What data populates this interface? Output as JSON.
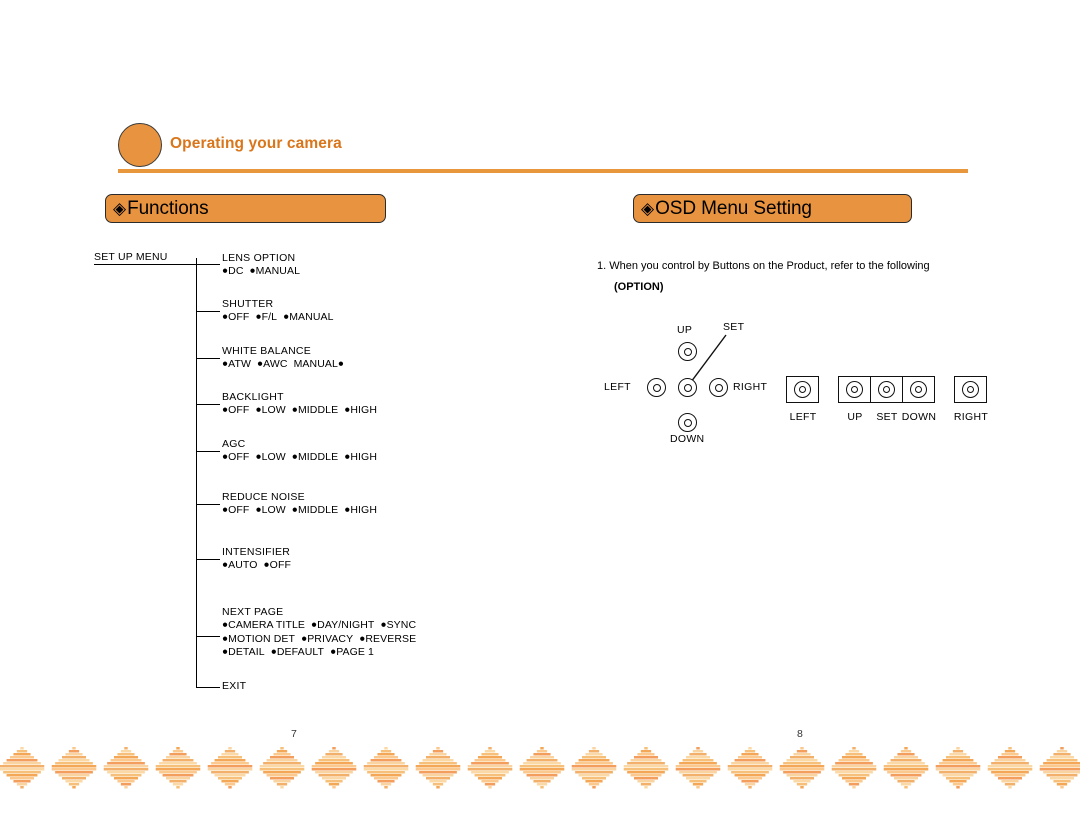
{
  "header": {
    "title": "Operating your camera",
    "circle_color": "#E8933F",
    "title_color": "#D9751A",
    "rule_color": "#E8973C"
  },
  "sections": {
    "functions": {
      "diamond": "◈",
      "label": "Functions"
    },
    "osd": {
      "diamond": "◈",
      "label": "OSD Menu Setting"
    }
  },
  "menu_tree": {
    "root_label": "SET UP MENU",
    "bullet": "●",
    "nodes": [
      {
        "title": "LENS OPTION",
        "options": [
          {
            "text": "DC",
            "bullet_before": true
          },
          {
            "text": "MANUAL",
            "bullet_before": true
          }
        ]
      },
      {
        "title": "SHUTTER",
        "options": [
          {
            "text": "OFF",
            "bullet_before": true
          },
          {
            "text": "F/L",
            "bullet_before": true
          },
          {
            "text": "MANUAL",
            "bullet_before": true
          }
        ]
      },
      {
        "title": "WHITE BALANCE",
        "options": [
          {
            "text": "ATW",
            "bullet_before": true
          },
          {
            "text": "AWC",
            "bullet_before": true
          },
          {
            "text": "MANUAL",
            "bullet_before": false
          }
        ]
      },
      {
        "title": "BACKLIGHT",
        "options": [
          {
            "text": "OFF",
            "bullet_before": true
          },
          {
            "text": "LOW",
            "bullet_before": true
          },
          {
            "text": "MIDDLE",
            "bullet_before": true
          },
          {
            "text": "HIGH",
            "bullet_before": true
          }
        ]
      },
      {
        "title": "AGC",
        "options": [
          {
            "text": "OFF",
            "bullet_before": true
          },
          {
            "text": "LOW",
            "bullet_before": true
          },
          {
            "text": "MIDDLE",
            "bullet_before": true
          },
          {
            "text": "HIGH",
            "bullet_before": true
          }
        ]
      },
      {
        "title": "REDUCE NOISE",
        "options": [
          {
            "text": "OFF",
            "bullet_before": true
          },
          {
            "text": "LOW",
            "bullet_before": true
          },
          {
            "text": "MIDDLE",
            "bullet_before": true
          },
          {
            "text": "HIGH",
            "bullet_before": true
          }
        ]
      },
      {
        "title": "INTENSIFIER",
        "options": [
          {
            "text": "AUTO",
            "bullet_before": true
          },
          {
            "text": "OFF",
            "bullet_before": true
          }
        ]
      },
      {
        "title": "NEXT  PAGE",
        "option_rows": [
          [
            {
              "text": "CAMERA TITLE",
              "bullet_before": true
            },
            {
              "text": "DAY/NIGHT",
              "bullet_before": true
            },
            {
              "text": "SYNC",
              "bullet_before": true
            }
          ],
          [
            {
              "text": "MOTION DET",
              "bullet_before": true
            },
            {
              "text": "PRIVACY",
              "bullet_before": true
            },
            {
              "text": "REVERSE",
              "bullet_before": true
            }
          ],
          [
            {
              "text": "DETAIL",
              "bullet_before": true
            },
            {
              "text": "DEFAULT",
              "bullet_before": true
            },
            {
              "text": "PAGE 1",
              "bullet_before": true
            }
          ]
        ]
      },
      {
        "title": "EXIT",
        "options": []
      }
    ]
  },
  "osd": {
    "instruction": "1. When you control by Buttons on the Product, refer to the following",
    "option_note": "(OPTION)",
    "dpad_labels": {
      "up": "UP",
      "down": "DOWN",
      "left": "LEFT",
      "right": "RIGHT",
      "set": "SET"
    },
    "button_strip": [
      {
        "label": "LEFT"
      },
      {
        "label": "UP"
      },
      {
        "label": "SET"
      },
      {
        "label": "DOWN"
      },
      {
        "label": "RIGHT"
      }
    ]
  },
  "page_numbers": {
    "left": "7",
    "right": "8"
  },
  "footer": {
    "diamond_colors": [
      "#FBD9A6",
      "#F7C07A",
      "#F4A857",
      "#FBC98E",
      "#F39E5C",
      "#FAD4A0",
      "#F2B06B"
    ]
  }
}
